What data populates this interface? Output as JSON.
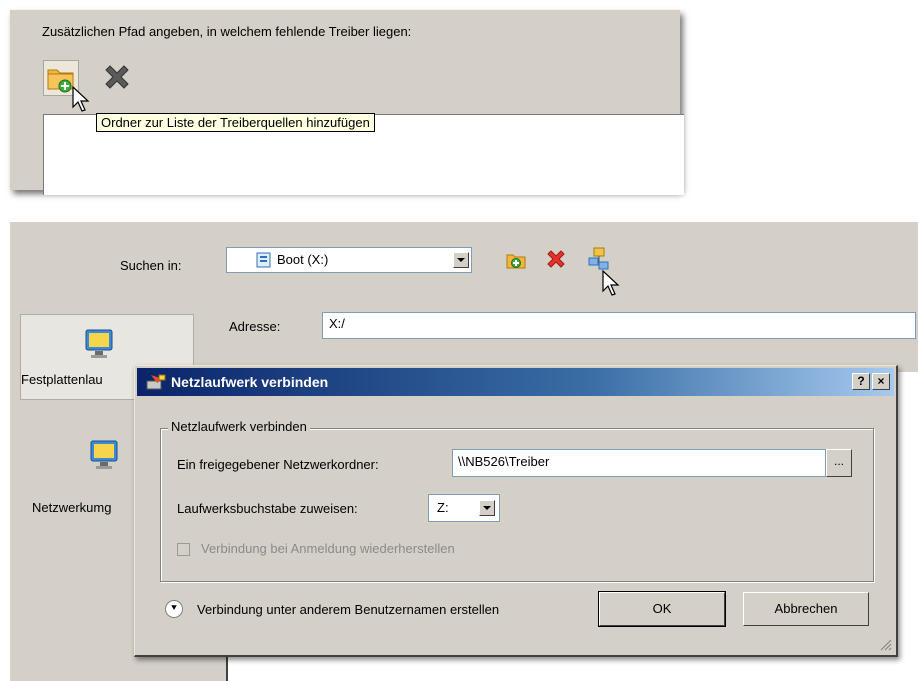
{
  "top": {
    "caption": "Zusätzlichen Pfad angeben, in welchem fehlende Treiber liegen:",
    "tooltip": "Ordner zur Liste der Treiberquellen hinzufügen",
    "add_icon": "folder-add-icon",
    "remove_icon": "x-icon"
  },
  "bottom": {
    "search_label": "Suchen in:",
    "search_value": "Boot (X:)",
    "toolbar_icons": [
      "folder-add-icon",
      "delete-icon",
      "network-drive-icon"
    ],
    "address_label": "Adresse:",
    "address_value": "X:/",
    "sidebar": [
      {
        "label": "Festplattenlau",
        "icon": "monitor-icon"
      },
      {
        "label": "Netzwerkumg",
        "icon": "monitor-icon"
      }
    ]
  },
  "dialog": {
    "title": "Netzlaufwerk verbinden",
    "help_btn": "?",
    "close_btn": "×",
    "group_title": "Netzlaufwerk verbinden",
    "share_label": "Ein freigegebener Netzwerkordner:",
    "share_value": "\\\\NB526\\Treiber",
    "browse_label": "...",
    "letter_label": "Laufwerksbuchstabe zuweisen:",
    "letter_value": "Z:",
    "reconnect_label": "Verbindung bei Anmeldung wiederherstellen",
    "reconnect_checked": false,
    "other_user_label": "Verbindung unter anderem Benutzernamen erstellen",
    "ok_label": "OK",
    "cancel_label": "Abbrechen"
  },
  "colors": {
    "window_bg": "#d4d0c8",
    "title_bar_start": "#0a246a",
    "title_bar_end": "#a6caf0",
    "tooltip_bg": "#ffffe1"
  }
}
